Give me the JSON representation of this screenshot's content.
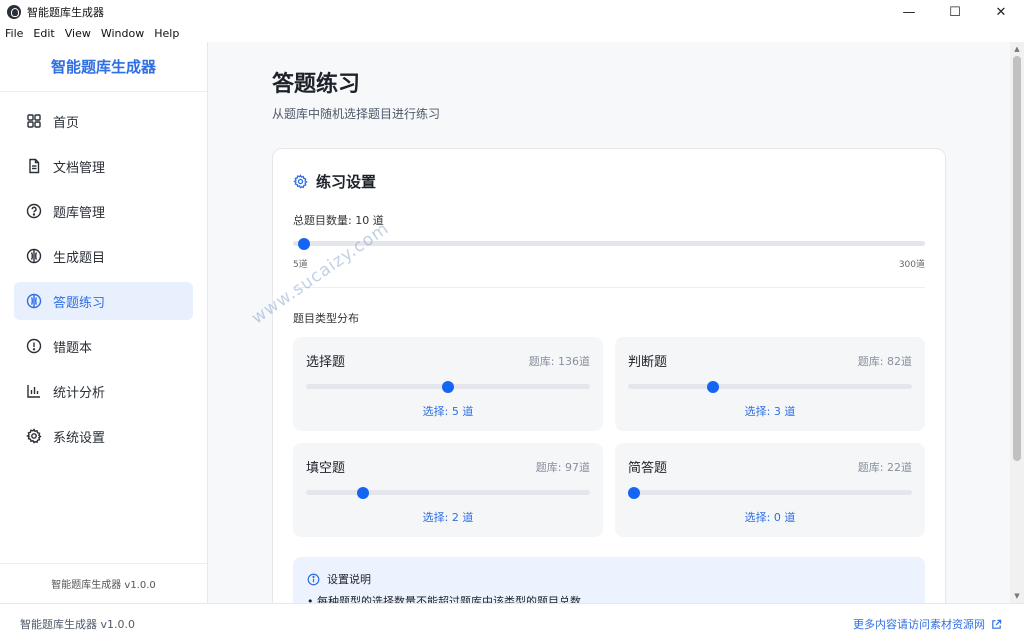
{
  "window": {
    "title": "智能题库生成器",
    "controls": [
      "—",
      "☐",
      "✕"
    ]
  },
  "menu": [
    "File",
    "Edit",
    "View",
    "Window",
    "Help"
  ],
  "sidebar": {
    "brand": "智能题库生成器",
    "items": [
      {
        "label": "首页",
        "icon": "grid-icon"
      },
      {
        "label": "文档管理",
        "icon": "document-icon"
      },
      {
        "label": "题库管理",
        "icon": "question-circle-icon"
      },
      {
        "label": "生成题目",
        "icon": "bulb-icon"
      },
      {
        "label": "答题练习",
        "icon": "bulb-icon",
        "active": true
      },
      {
        "label": "错题本",
        "icon": "exclamation-circle-icon"
      },
      {
        "label": "统计分析",
        "icon": "bar-chart-icon"
      },
      {
        "label": "系统设置",
        "icon": "gear-icon"
      }
    ],
    "footer": "智能题库生成器 v1.0.0"
  },
  "main": {
    "title": "答题练习",
    "subtitle": "从题库中随机选择题目进行练习",
    "settings": {
      "title": "练习设置",
      "total_label": "总题目数量: 10 道",
      "total_value": 10,
      "total_min": 5,
      "total_max": 300,
      "min_label": "5道",
      "max_label": "300道",
      "distribution_label": "题目类型分布",
      "types": [
        {
          "name": "选择题",
          "bank": "题库: 136道",
          "bank_count": 136,
          "selected": 5,
          "selected_label": "选择: 5 道",
          "slider_fraction": 0.5
        },
        {
          "name": "判断题",
          "bank": "题库: 82道",
          "bank_count": 82,
          "selected": 3,
          "selected_label": "选择: 3 道",
          "slider_fraction": 0.3
        },
        {
          "name": "填空题",
          "bank": "题库: 97道",
          "bank_count": 97,
          "selected": 2,
          "selected_label": "选择: 2 道",
          "slider_fraction": 0.2
        },
        {
          "name": "简答题",
          "bank": "题库: 22道",
          "bank_count": 22,
          "selected": 0,
          "selected_label": "选择: 0 道",
          "slider_fraction": 0
        }
      ],
      "info_title": "设置说明",
      "info_bullet": "• 每种题型的选择数量不能超过题库中该类型的题目总数"
    }
  },
  "statusbar": {
    "left": "智能题库生成器 v1.0.0",
    "right": "更多内容请访问素材资源网"
  },
  "watermark": "www.sucaizy.com",
  "colors": {
    "accent": "#2f6fe4",
    "slider_thumb": "#1565f5",
    "active_nav_bg": "#e9f0fd",
    "info_bg": "#ecf3fe"
  }
}
